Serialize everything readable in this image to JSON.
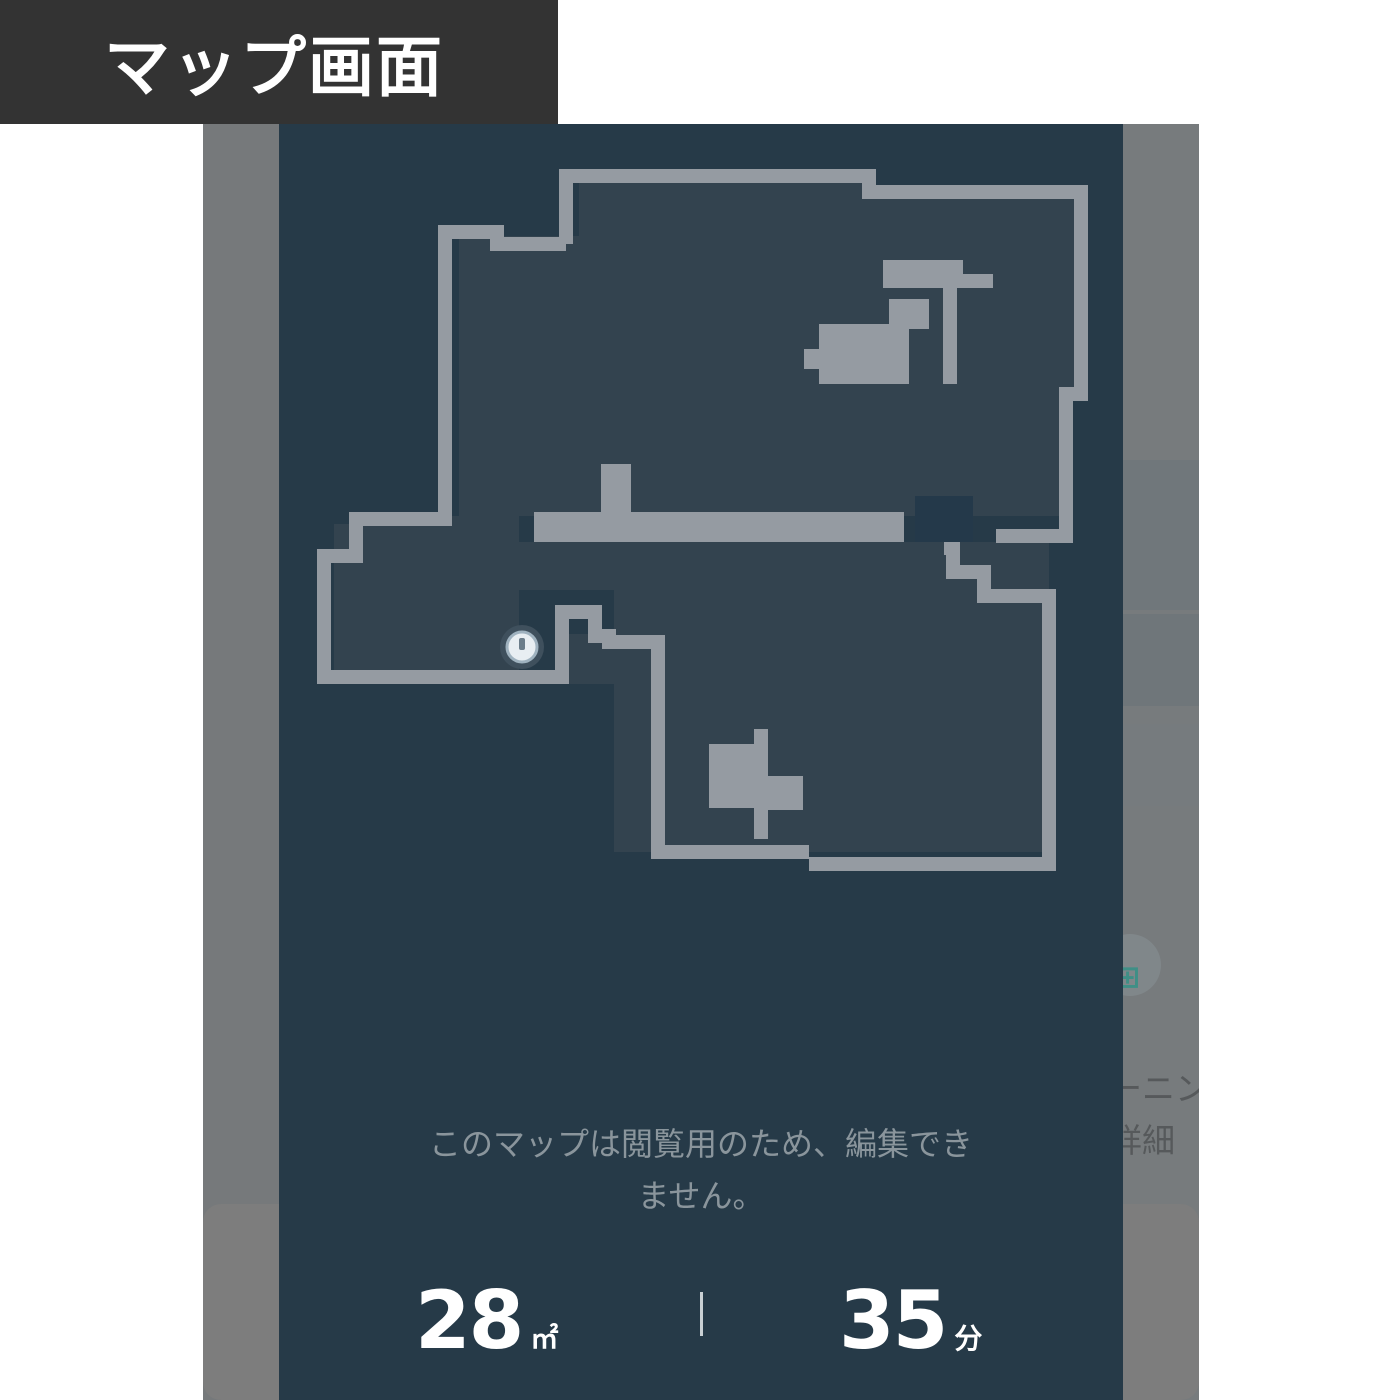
{
  "header": {
    "title": "マップ画面"
  },
  "background_app": {
    "icon": "robot-icon",
    "text_line1": "ーニン",
    "text_line2": "詳細"
  },
  "map": {
    "robot_icon": "robot-vacuum-icon",
    "notice_line1": "このマップは閲覧用のため、編集でき",
    "notice_line2": "ません。"
  },
  "stats": {
    "area_value": "28",
    "area_unit": "㎡",
    "time_value": "35",
    "time_unit": "分"
  },
  "colors": {
    "banner": "#333333",
    "map_background": "#263a48",
    "room_fill": "#33434f",
    "wall": "#959ba2",
    "text_primary": "#ffffff",
    "text_secondary": "#8a959c"
  }
}
